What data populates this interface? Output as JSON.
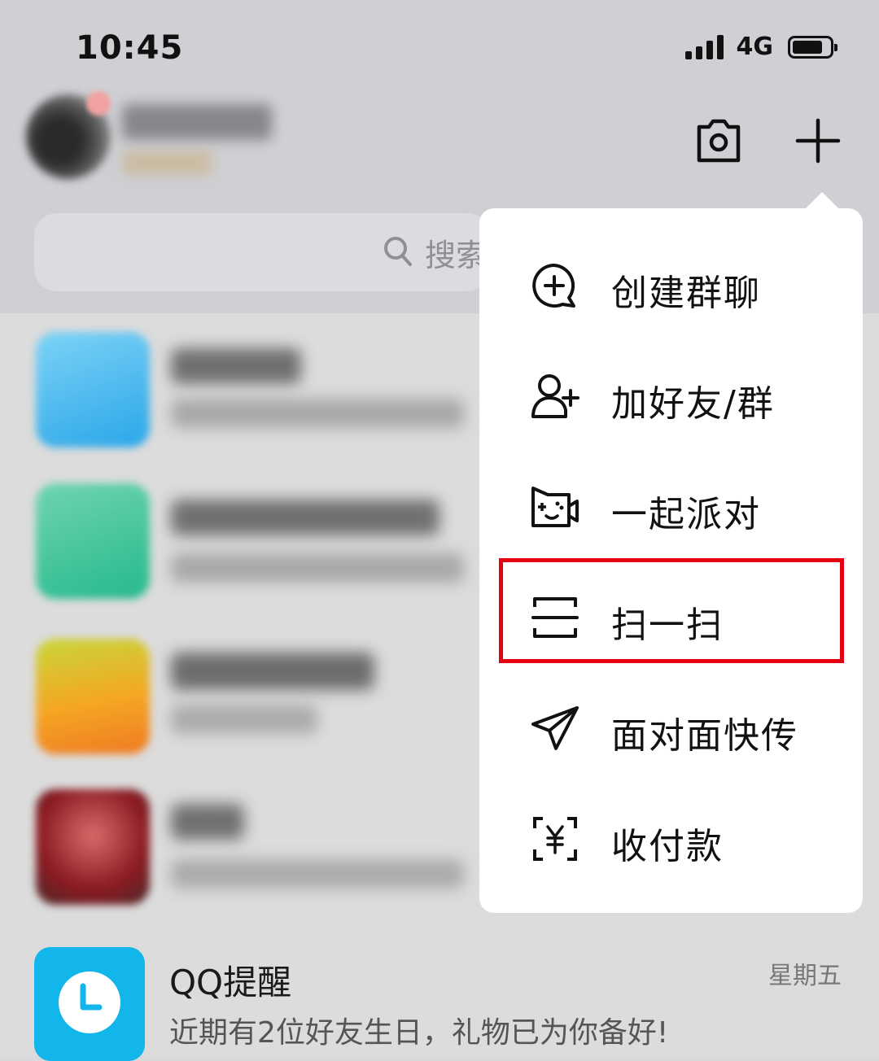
{
  "status_bar": {
    "time": "10:45",
    "network": "4G"
  },
  "search": {
    "placeholder": "搜索"
  },
  "menu": {
    "items": [
      {
        "label": "创建群聊",
        "icon": "create-group-chat-icon"
      },
      {
        "label": "加好友/群",
        "icon": "add-friend-icon"
      },
      {
        "label": "一起派对",
        "icon": "party-game-icon"
      },
      {
        "label": "扫一扫",
        "icon": "scan-icon",
        "highlighted": true
      },
      {
        "label": "面对面快传",
        "icon": "paper-plane-icon"
      },
      {
        "label": "收付款",
        "icon": "payment-scan-icon"
      }
    ]
  },
  "conversations": {
    "qq_reminder": {
      "title": "QQ提醒",
      "subtitle": "近期有2位好友生日，礼物已为你备好!",
      "time": "星期五"
    }
  },
  "colors": {
    "highlight": "#e60012",
    "qq_reminder_icon": "#12b6ea"
  }
}
